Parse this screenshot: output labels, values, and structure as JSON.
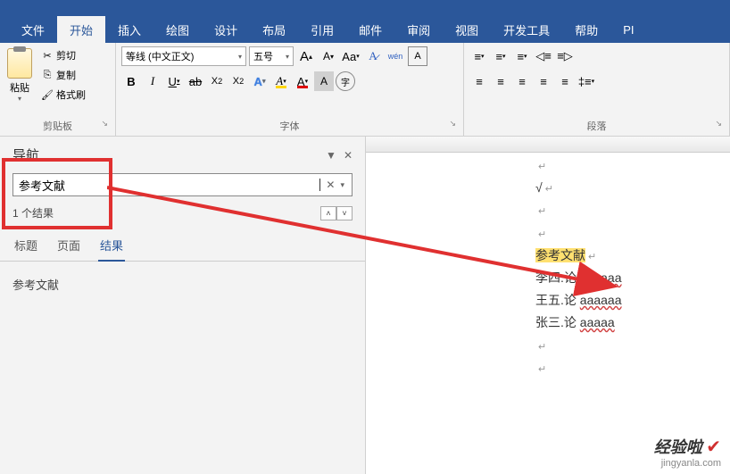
{
  "tabs": {
    "file": "文件",
    "home": "开始",
    "insert": "插入",
    "draw": "绘图",
    "design": "设计",
    "layout": "布局",
    "references": "引用",
    "mailings": "邮件",
    "review": "审阅",
    "view": "视图",
    "developer": "开发工具",
    "help": "帮助",
    "pdf": "PI"
  },
  "clipboard": {
    "paste": "粘贴",
    "cut": "剪切",
    "copy": "复制",
    "format_painter": "格式刷",
    "group_label": "剪贴板"
  },
  "font": {
    "name": "等线 (中文正文)",
    "size": "五号",
    "group_label": "字体",
    "buttons": {
      "increase": "A",
      "decrease": "A",
      "change_case": "Aa",
      "clear": "A",
      "phonetic": "wén",
      "bold": "B",
      "italic": "I",
      "underline": "U",
      "strike": "ab",
      "sub": "X₂",
      "sup": "X²",
      "effects": "A",
      "highlight": "A",
      "font_color": "A",
      "char_shading": "A",
      "enclose": "字"
    }
  },
  "paragraph": {
    "group_label": "段落"
  },
  "navigation": {
    "title": "导航",
    "search_value": "参考文献",
    "result_count": "1 个结果",
    "tabs": {
      "headings": "标题",
      "pages": "页面",
      "results": "结果"
    },
    "result_item": "参考文献"
  },
  "document": {
    "check": "√",
    "ref_heading": "参考文献",
    "lines": [
      {
        "author": "李四.论",
        "tail": "aaaaaa"
      },
      {
        "author": "王五.论",
        "tail": "aaaaaa"
      },
      {
        "author": "张三.论",
        "tail": "aaaaa"
      }
    ]
  },
  "watermark": {
    "brand": "经验啦",
    "url": "jingyanla.com"
  }
}
